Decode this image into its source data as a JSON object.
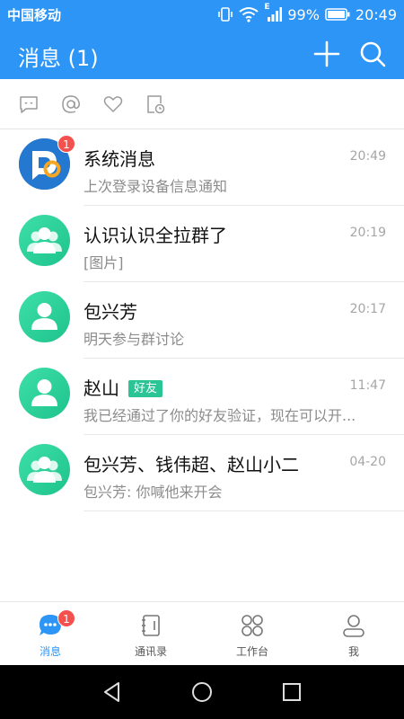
{
  "status_bar": {
    "carrier": "中国移动",
    "network": "E",
    "battery": "99%",
    "time": "20:49"
  },
  "header": {
    "title": "消息 (1)",
    "add_icon": "plus-icon",
    "search_icon": "search-icon"
  },
  "filter_bar": {
    "icons": [
      "chat-bubble-icon",
      "at-icon",
      "heart-icon",
      "doc-clock-icon"
    ]
  },
  "conversations": [
    {
      "name": "系统消息",
      "preview": "上次登录设备信息通知",
      "time": "20:49",
      "badge": "1",
      "avatar": "system-logo"
    },
    {
      "name": "认识认识全拉群了",
      "preview": "[图片]",
      "time": "20:19",
      "avatar": "group"
    },
    {
      "name": "包兴芳",
      "preview": "明天参与群讨论",
      "time": "20:17",
      "avatar": "person"
    },
    {
      "name": "赵山",
      "tag": "好友",
      "preview": "我已经通过了你的好友验证，现在可以开...",
      "time": "11:47",
      "avatar": "person"
    },
    {
      "name": "包兴芳、钱伟超、赵山小二",
      "preview": "包兴芳: 你喊他来开会",
      "time": "04-20",
      "avatar": "group"
    }
  ],
  "tab_bar": {
    "tabs": [
      {
        "label": "消息",
        "icon": "message-icon",
        "badge": "1",
        "active": true
      },
      {
        "label": "通讯录",
        "icon": "contacts-icon"
      },
      {
        "label": "工作台",
        "icon": "workbench-icon"
      },
      {
        "label": "我",
        "icon": "profile-icon"
      }
    ]
  },
  "colors": {
    "primary": "#2c95f6",
    "badge": "#f4504d",
    "avatar_green": "#26c995",
    "tag_green": "#2ac495"
  }
}
